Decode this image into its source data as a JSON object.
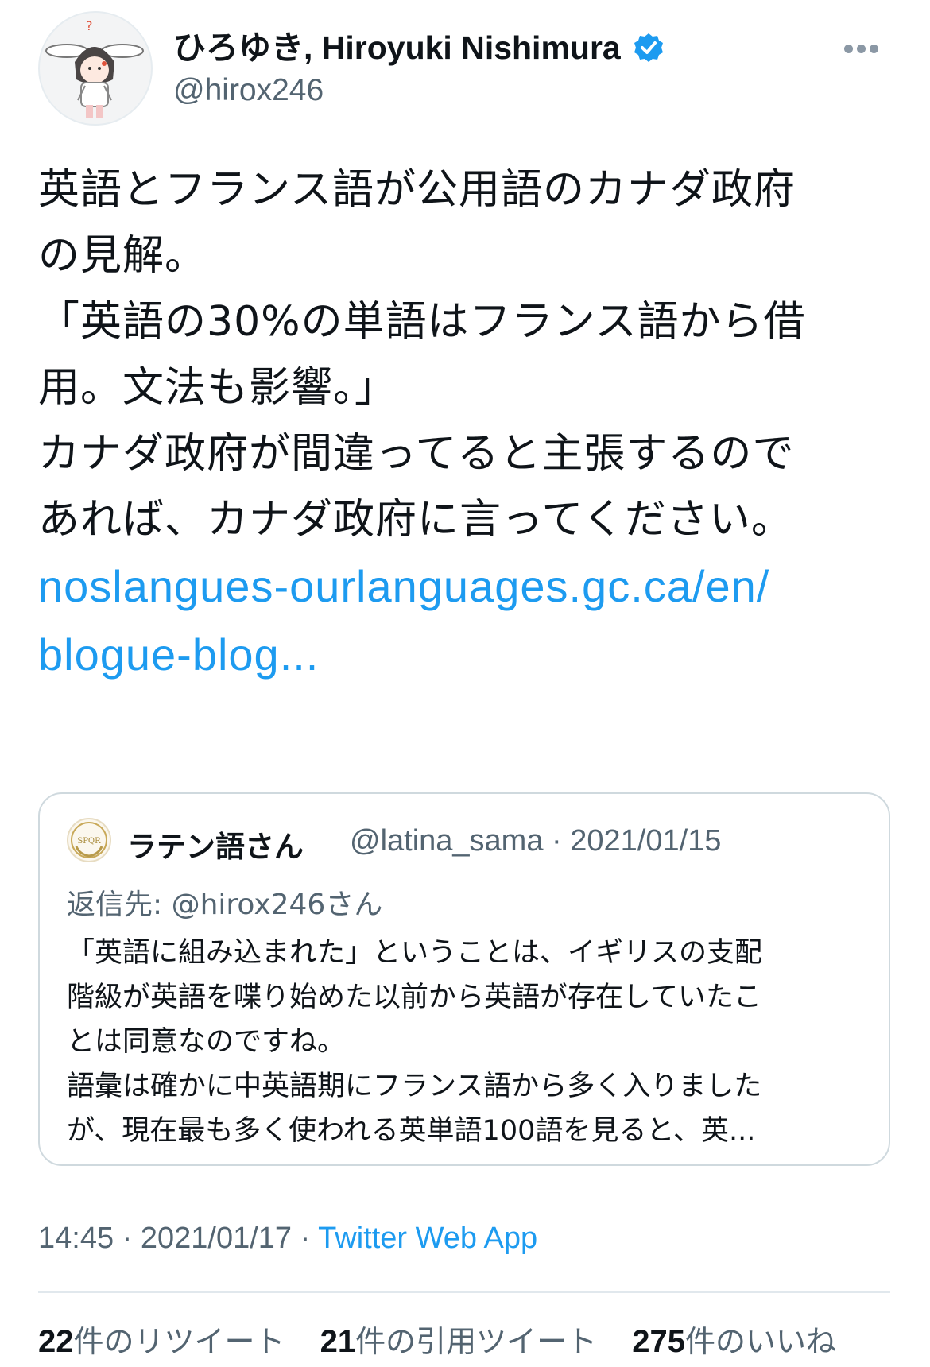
{
  "tweet": {
    "author": {
      "display_name": "ひろゆき, Hiroyuki Nishimura",
      "handle": "@hirox246",
      "verified": true,
      "avatar_icon": "bunny-ear-character-avatar"
    },
    "more_icon": "more-horizontal-icon",
    "text_lines": [
      "英語とフランス語が公用語のカナダ政府",
      "の見解。",
      "「英語の30%の単語はフランス語から借",
      "用。文法も影響。」",
      "カナダ政府が間違ってると主張するので",
      "あれば、カナダ政府に言ってください。"
    ],
    "link_lines": [
      "noslangues-ourlanguages.gc.ca/en/",
      "blogue-blog..."
    ],
    "quoted": {
      "display_name": "ラテン語さん",
      "meta": "@latina_sama · 2021/01/15",
      "avatar_icon": "spqr-laurel-avatar",
      "reply_to": "返信先: @hirox246さん",
      "text_lines": [
        "「英語に組み込まれた」ということは、イギリスの支配",
        "階級が英語を喋り始めた以前から英語が存在していたこ",
        "とは同意なのですね。",
        "語彙は確かに中英語期にフランス語から多く入りました",
        "が、現在最も多く使われる英単語100語を見ると、英..."
      ]
    },
    "timestamp": "14:45 · 2021/01/17 · ",
    "source_app": "Twitter Web App",
    "stats": {
      "retweets_count": "22",
      "retweets_label": "件のリツイート",
      "quotes_count": "21",
      "quotes_label": "件の引用ツイート",
      "likes_count": "275",
      "likes_label": "件のいいね"
    }
  },
  "colors": {
    "link": "#1d9bf0",
    "secondary_text": "#536471",
    "primary_text": "#0f1419",
    "border": "#cfd9de"
  }
}
